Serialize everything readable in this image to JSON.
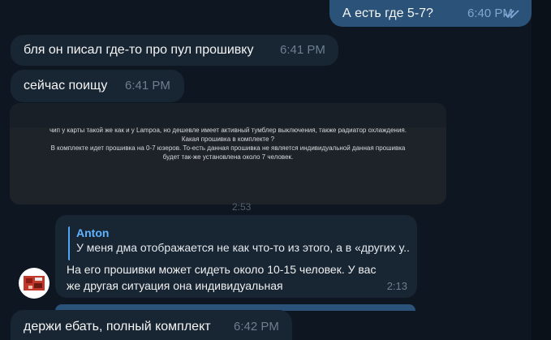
{
  "messages": {
    "out1": {
      "text": "А есть где 5-7?",
      "time": "6:40 PM",
      "status_icon": "double-check-icon"
    },
    "in1": {
      "text": "бля он писал где-то про пул прошивку",
      "time": "6:41 PM"
    },
    "in2": {
      "text": "сейчас поищу",
      "time": "6:41 PM"
    },
    "in3": {
      "text": "держи ебать, полный комплект",
      "time": "6:42 PM"
    }
  },
  "screenshot": {
    "lines": [
      "чип у карты такой же как и у Lampoa, но дешевле имеет активный тумблер выключения, также радиатор охлаждения.",
      "Какая прошивка в комплекте ?",
      "В комплекте идет прошивка на 0-7 юзеров. То-есть данная прошивка не является индивидуальной данная прошивка",
      "будет так-же установлена около 7 человек."
    ],
    "time_peek": "2:53"
  },
  "reply": {
    "quote_author": "Anton",
    "quote_text": "У меня дма отображается не как что-то из этого, а в «других у...",
    "body": "На его прошивки может сидеть около 10-15 человек. У вас же другая ситуация она индивидуальная",
    "time": "2:13"
  },
  "colors": {
    "background": "#0e1621",
    "incoming": "#182533",
    "outgoing": "#2b5278",
    "accent": "#5fb3ff"
  }
}
